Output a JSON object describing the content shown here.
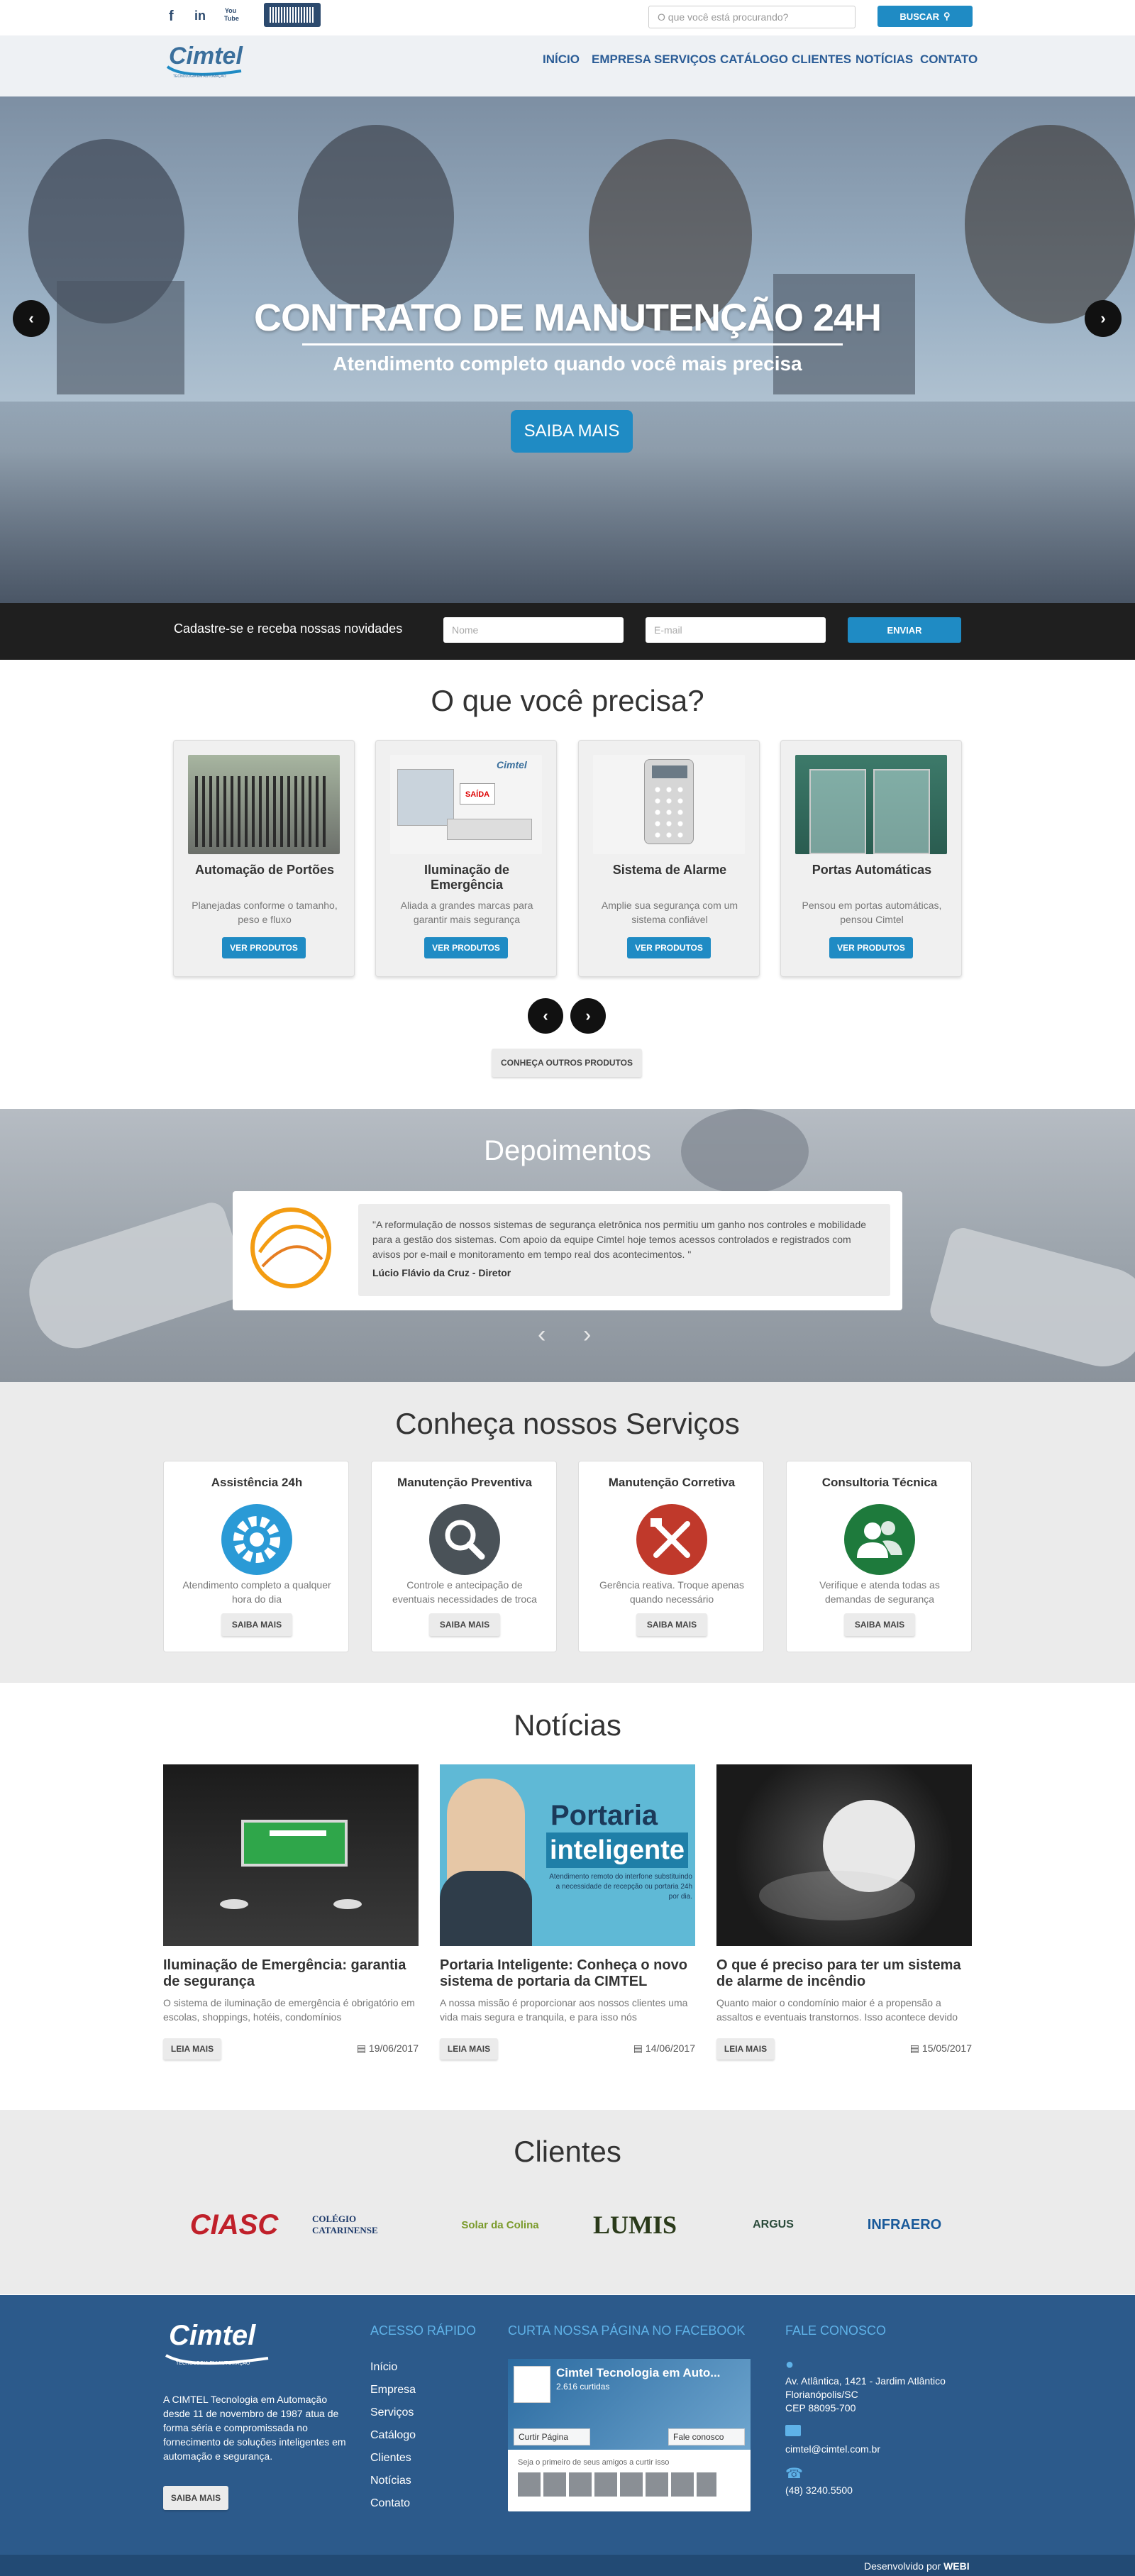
{
  "topbar": {
    "social": [
      "f",
      "in",
      "You Tube"
    ],
    "search_placeholder": "O que você está procurando?",
    "search_button": "BUSCAR"
  },
  "header": {
    "logo": "Cimtel",
    "logo_tagline": "TECNOLOGIA EM AUTOMAÇÃO",
    "nav": [
      "INÍCIO",
      "EMPRESA",
      "SERVIÇOS",
      "CATÁLOGO",
      "CLIENTES",
      "NOTÍCIAS",
      "CONTATO"
    ]
  },
  "hero": {
    "title": "CONTRATO DE MANUTENÇÃO 24H",
    "subtitle": "Atendimento completo quando você mais precisa",
    "button": "SAIBA MAIS"
  },
  "newsletter": {
    "text": "Cadastre-se e receba nossas novidades",
    "name_placeholder": "Nome",
    "email_placeholder": "E-mail",
    "button": "ENVIAR"
  },
  "products": {
    "heading": "O que você precisa?",
    "items": [
      {
        "title": "Automação de Portões",
        "desc": "Planejadas conforme o tamanho, peso e fluxo",
        "button": "VER PRODUTOS"
      },
      {
        "title": "Iluminação de Emergência",
        "desc": "Aliada a grandes marcas para garantir mais segurança",
        "button": "VER PRODUTOS"
      },
      {
        "title": "Sistema de Alarme",
        "desc": "Amplie sua segurança com um sistema confiável",
        "button": "VER PRODUTOS"
      },
      {
        "title": "Portas Automáticas",
        "desc": "Pensou em portas automáticas, pensou Cimtel",
        "button": "VER PRODUTOS"
      }
    ],
    "img_labels": {
      "cimtel": "Cimtel",
      "saida": "SAÍDA"
    },
    "more_button": "CONHEÇA OUTROS PRODUTOS"
  },
  "testimonials": {
    "heading": "Depoimentos",
    "quote": "\"A reformulação de nossos sistemas de segurança eletrônica nos permitiu um ganho nos controles e mobilidade para a gestão dos sistemas. Com apoio da equipe Cimtel hoje temos acessos controlados e registrados com avisos por e-mail e monitoramento em tempo real dos acontecimentos. \"",
    "author": "Lúcio Flávio da Cruz - Diretor"
  },
  "services": {
    "heading": "Conheça nossos Serviços",
    "items": [
      {
        "title": "Assistência 24h",
        "desc": "Atendimento completo a qualquer hora do dia",
        "button": "SAIBA MAIS",
        "icon": "gear-icon",
        "color": "#2a9ad6"
      },
      {
        "title": "Manutenção Preventiva",
        "desc": "Controle e antecipação de eventuais necessidades de troca",
        "button": "SAIBA MAIS",
        "icon": "magnifier-icon",
        "color": "#4a5258"
      },
      {
        "title": "Manutenção Corretiva",
        "desc": "Gerência reativa. Troque apenas quando necessário",
        "button": "SAIBA MAIS",
        "icon": "tools-icon",
        "color": "#c0392b"
      },
      {
        "title": "Consultoria Técnica",
        "desc": "Verifique e atenda todas as demandas de segurança",
        "button": "SAIBA MAIS",
        "icon": "users-icon",
        "color": "#1e7a3c"
      }
    ]
  },
  "news": {
    "heading": "Notícias",
    "items": [
      {
        "title": "Iluminação de Emergência: garantia de segurança",
        "desc": "O sistema de iluminação de emergência é obrigatório em escolas, shoppings, hotéis, condomínios",
        "button": "LEIA MAIS",
        "date": "19/06/2017"
      },
      {
        "title": "Portaria Inteligente: Conheça o novo sistema de portaria da CIMTEL",
        "desc": "A nossa missão é proporcionar aos nossos clientes uma vida mais segura e tranquila, e para isso nós",
        "button": "LEIA MAIS",
        "date": "14/06/2017"
      },
      {
        "title": "O que é preciso para ter um sistema de alarme de incêndio",
        "desc": "Quanto maior o condomínio maior é a propensão a assaltos e eventuais transtornos. Isso acontece devido",
        "button": "LEIA MAIS",
        "date": "15/05/2017"
      }
    ],
    "portaria_img": {
      "line1": "Portaria",
      "line2": "inteligente",
      "caption": "Atendimento remoto do interfone substituindo a necessidade de recepção ou portaria 24h por dia."
    }
  },
  "clients": {
    "heading": "Clientes",
    "logos": [
      "CIASC",
      "COLÉGIO CATARINENSE",
      "Solar da Colina",
      "LUMIS",
      "ARGUS",
      "INFRAERO"
    ]
  },
  "footer": {
    "about": "A CIMTEL Tecnologia em Automação desde 11 de novembro de 1987 atua de forma séria e compromissada no fornecimento de soluções inteligentes em automação e segurança.",
    "about_button": "SAIBA MAIS",
    "quick_heading": "ACESSO RÁPIDO",
    "links": [
      "Início",
      "Empresa",
      "Serviços",
      "Catálogo",
      "Clientes",
      "Notícias",
      "Contato"
    ],
    "fb_heading": "CURTA NOSSA PÁGINA NO FACEBOOK",
    "fb_page": "Cimtel Tecnologia em Auto...",
    "fb_likes": "2.616 curtidas",
    "fb_like_btn": "Curtir Página",
    "fb_contact_btn": "Fale conosco",
    "fb_friends": "Seja o primeiro de seus amigos a curtir isso",
    "contact_heading": "FALE CONOSCO",
    "address": [
      "Av. Atlântica, 1421 - Jardim Atlântico",
      "Florianópolis/SC",
      "CEP 88095-700"
    ],
    "email": "cimtel@cimtel.com.br",
    "phone": "(48) 3240.5500",
    "credit_prefix": "Desenvolvido por",
    "credit_brand": "WEBI"
  }
}
